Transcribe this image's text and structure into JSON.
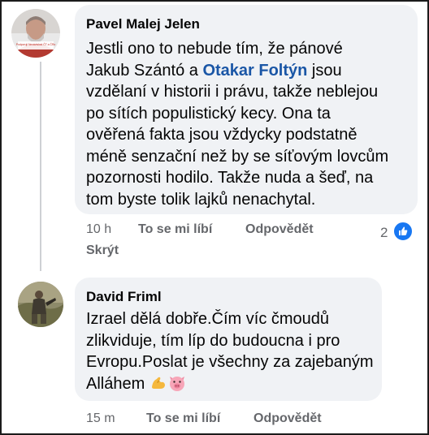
{
  "comments": [
    {
      "author": "Pavel Malej Jelen",
      "avatar_badge_text": "Podporuji Nezávislost ČT a ČRo",
      "text_before_mention": "Jestli ono to nebude tím, že pánové\nJakub Szántó a ",
      "mention": "Otakar Foltýn",
      "text_after_mention": " jsou\nvzdělaní v historii i právu, takže neblejou\npo sítích populistický kecy. Ona ta\nověřená fakta jsou vždycky podstatně\nméně senzační než by se síťovým lovcům\npozornosti hodilo. Takže nuda a šeď, na\ntom byste tolik lajků nenachytal.",
      "time": "10 h",
      "like_action": "To se mi líbí",
      "reply_action": "Odpovědět",
      "hide_action": "Skrýt",
      "reaction_count": "2",
      "reaction_icon": "like-icon"
    },
    {
      "author": "David Friml",
      "text": "Izrael dělá dobře.Čím víc čmoudů\nzlikviduje, tím líp do budoucna i pro\nEvropu.Poslat je všechny za zajebaným\nAlláhem ",
      "emojis": [
        "flexed-biceps-emoji",
        "pig-face-emoji"
      ],
      "time": "15 m",
      "like_action": "To se mi líbí",
      "reply_action": "Odpovědět"
    }
  ],
  "colors": {
    "bubble": "#f0f2f5",
    "meta_text": "#65676b",
    "mention": "#1a56a6",
    "like_badge": "#1877f2"
  }
}
